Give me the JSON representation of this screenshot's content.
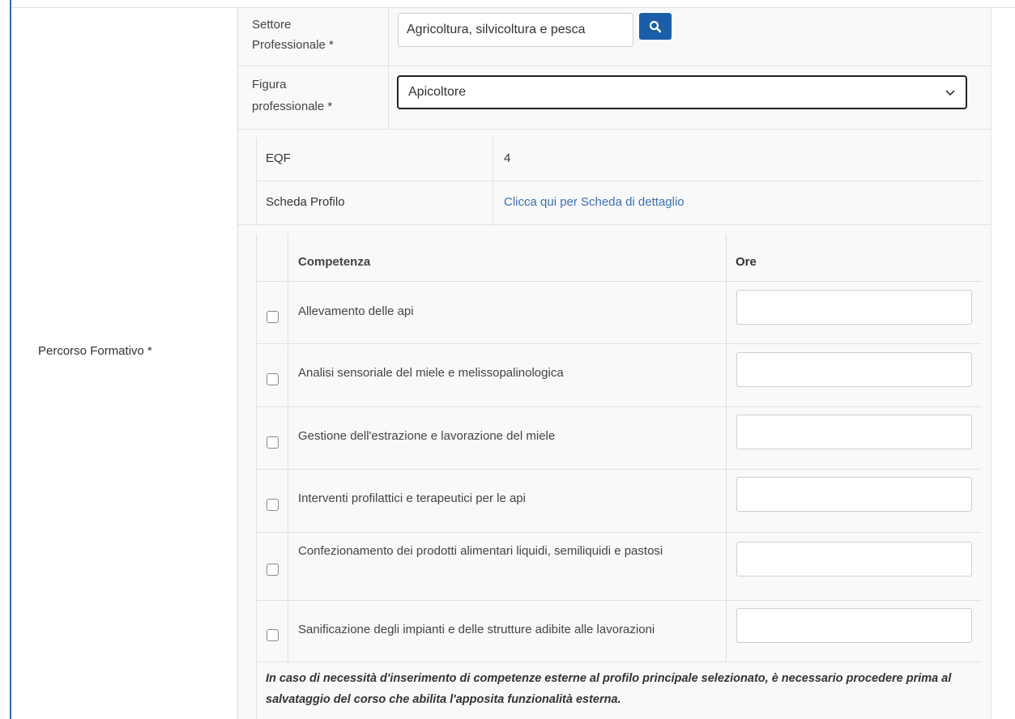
{
  "form": {
    "percorso_label": "Percorso Formativo *",
    "settore_label_1": "Settore",
    "settore_label_2": "Professionale *",
    "settore_value": "Agricoltura, silvicoltura e pesca",
    "figura_label_1": "Figura",
    "figura_label_2": "professionale *",
    "figura_value": "Apicoltore",
    "eqf_label": "EQF",
    "eqf_value": "4",
    "scheda_label": "Scheda Profilo",
    "scheda_link": "Clicca qui per Scheda di dettaglio"
  },
  "table": {
    "header_competenza": "Competenza",
    "header_ore": "Ore",
    "rows": [
      {
        "text": "Allevamento delle api",
        "ore": ""
      },
      {
        "text": "Analisi sensoriale del miele e melissopalinologica",
        "ore": ""
      },
      {
        "text": "Gestione dell'estrazione e lavorazione del miele",
        "ore": ""
      },
      {
        "text": "Interventi profilattici e terapeutici per le api",
        "ore": ""
      },
      {
        "text": "Confezionamento dei prodotti alimentari liquidi, semiliquidi e pastosi",
        "ore": ""
      },
      {
        "text": "Sanificazione degli impianti e delle strutture adibite alle lavorazioni",
        "ore": ""
      }
    ],
    "note": "In caso di necessità d'inserimento di competenze esterne al profilo principale selezionato, è necessario procedere prima al salvataggio del corso che abilita l'apposita funzionalità esterna."
  },
  "icons": {
    "search": "search-icon",
    "dropdown": "chevron-down-icon"
  },
  "colors": {
    "accent": "#1a5ea8",
    "link": "#3a6fb0",
    "left_bar": "#2d6db5"
  }
}
